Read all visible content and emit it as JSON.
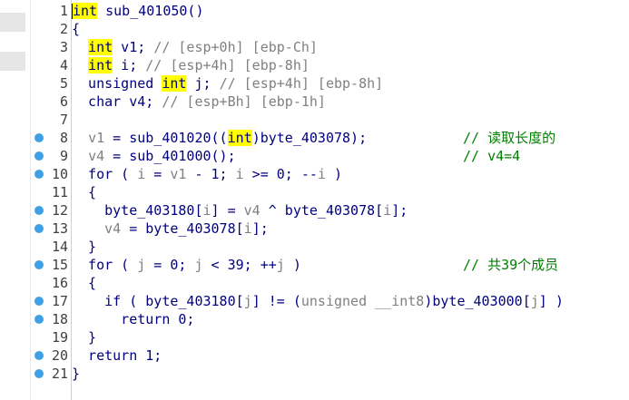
{
  "window": {
    "background": "#ffffff",
    "accent": "#3fa0e6",
    "highlight": "#ffff00"
  },
  "lines": [
    {
      "num": "1",
      "bp": false,
      "segs": [
        {
          "t": "int",
          "c": "kw hl"
        },
        {
          "t": " sub_401050()",
          "c": "kw"
        }
      ]
    },
    {
      "num": "2",
      "bp": false,
      "segs": [
        {
          "t": "{",
          "c": "kw"
        }
      ]
    },
    {
      "num": "3",
      "bp": false,
      "segs": [
        {
          "t": "  "
        },
        {
          "t": "int",
          "c": "kw hl"
        },
        {
          "t": " v1; ",
          "c": "kw"
        },
        {
          "t": "// [esp+0h] [ebp-Ch]",
          "c": "cm"
        }
      ]
    },
    {
      "num": "4",
      "bp": false,
      "segs": [
        {
          "t": "  "
        },
        {
          "t": "int",
          "c": "kw hl"
        },
        {
          "t": " i; ",
          "c": "kw"
        },
        {
          "t": "// [esp+4h] [ebp-8h]",
          "c": "cm"
        }
      ]
    },
    {
      "num": "5",
      "bp": false,
      "segs": [
        {
          "t": "  unsigned ",
          "c": "kw"
        },
        {
          "t": "int",
          "c": "kw hl"
        },
        {
          "t": " j; ",
          "c": "kw"
        },
        {
          "t": "// [esp+4h] [ebp-8h]",
          "c": "cm"
        }
      ]
    },
    {
      "num": "6",
      "bp": false,
      "segs": [
        {
          "t": "  char v4; ",
          "c": "kw"
        },
        {
          "t": "// [esp+Bh] [ebp-1h]",
          "c": "cm"
        }
      ]
    },
    {
      "num": "7",
      "bp": false,
      "segs": []
    },
    {
      "num": "8",
      "bp": true,
      "segs": [
        {
          "t": "  "
        },
        {
          "t": "v1",
          "c": "cm"
        },
        {
          "t": " = sub_401020((",
          "c": "kw"
        },
        {
          "t": "int",
          "c": "kw hl"
        },
        {
          "t": ")byte_403078);",
          "c": "kw"
        }
      ],
      "comment": "// 读取长度的"
    },
    {
      "num": "9",
      "bp": true,
      "segs": [
        {
          "t": "  "
        },
        {
          "t": "v4",
          "c": "cm"
        },
        {
          "t": " = sub_401000();",
          "c": "kw"
        }
      ],
      "comment": "// v4=4"
    },
    {
      "num": "10",
      "bp": true,
      "segs": [
        {
          "t": "  for ( ",
          "c": "kw"
        },
        {
          "t": "i",
          "c": "cm"
        },
        {
          "t": " = ",
          "c": "kw"
        },
        {
          "t": "v1",
          "c": "cm"
        },
        {
          "t": " - 1; ",
          "c": "kw"
        },
        {
          "t": "i",
          "c": "cm"
        },
        {
          "t": " >= 0; --",
          "c": "kw"
        },
        {
          "t": "i",
          "c": "cm"
        },
        {
          "t": " )",
          "c": "kw"
        }
      ]
    },
    {
      "num": "11",
      "bp": false,
      "segs": [
        {
          "t": "  {",
          "c": "kw"
        }
      ]
    },
    {
      "num": "12",
      "bp": true,
      "segs": [
        {
          "t": "    byte_403180[",
          "c": "kw"
        },
        {
          "t": "i",
          "c": "cm"
        },
        {
          "t": "] = ",
          "c": "kw"
        },
        {
          "t": "v4",
          "c": "cm"
        },
        {
          "t": " ^ byte_403078[",
          "c": "kw"
        },
        {
          "t": "i",
          "c": "cm"
        },
        {
          "t": "];",
          "c": "kw"
        }
      ]
    },
    {
      "num": "13",
      "bp": true,
      "segs": [
        {
          "t": "    "
        },
        {
          "t": "v4",
          "c": "cm"
        },
        {
          "t": " = byte_403078[",
          "c": "kw"
        },
        {
          "t": "i",
          "c": "cm"
        },
        {
          "t": "];",
          "c": "kw"
        }
      ]
    },
    {
      "num": "14",
      "bp": false,
      "segs": [
        {
          "t": "  }",
          "c": "kw"
        }
      ]
    },
    {
      "num": "15",
      "bp": true,
      "segs": [
        {
          "t": "  for ( ",
          "c": "kw"
        },
        {
          "t": "j",
          "c": "cm"
        },
        {
          "t": " = 0; ",
          "c": "kw"
        },
        {
          "t": "j",
          "c": "cm"
        },
        {
          "t": " < 39; ++",
          "c": "kw"
        },
        {
          "t": "j",
          "c": "cm"
        },
        {
          "t": " )",
          "c": "kw"
        }
      ],
      "comment": "// 共39个成员"
    },
    {
      "num": "16",
      "bp": false,
      "segs": [
        {
          "t": "  {",
          "c": "kw"
        }
      ]
    },
    {
      "num": "17",
      "bp": true,
      "segs": [
        {
          "t": "    if ( byte_403180[",
          "c": "kw"
        },
        {
          "t": "j",
          "c": "cm"
        },
        {
          "t": "] != (",
          "c": "kw"
        },
        {
          "t": "unsigned __int8",
          "c": "cm"
        },
        {
          "t": ")byte_403000[",
          "c": "kw"
        },
        {
          "t": "j",
          "c": "cm"
        },
        {
          "t": "] )",
          "c": "kw"
        }
      ]
    },
    {
      "num": "18",
      "bp": true,
      "segs": [
        {
          "t": "      return 0;",
          "c": "kw"
        }
      ]
    },
    {
      "num": "19",
      "bp": false,
      "segs": [
        {
          "t": "  }",
          "c": "kw"
        }
      ]
    },
    {
      "num": "20",
      "bp": true,
      "segs": [
        {
          "t": "  return 1;",
          "c": "kw"
        }
      ]
    },
    {
      "num": "21",
      "bp": true,
      "segs": [
        {
          "t": "}",
          "c": "kw"
        }
      ]
    }
  ]
}
